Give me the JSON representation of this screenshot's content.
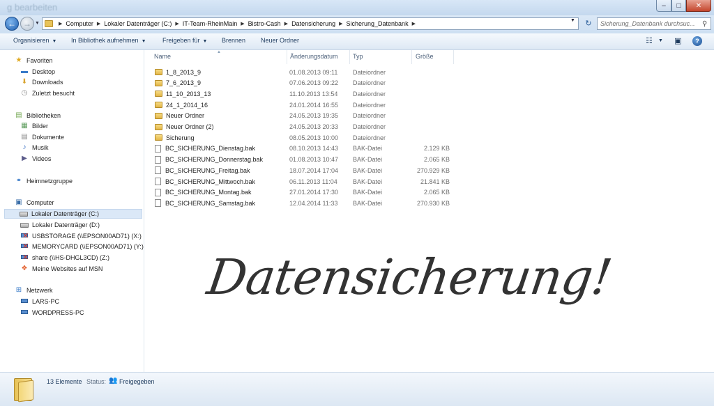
{
  "window": {
    "title_ghost": "g bearbeiten",
    "controls": {
      "minimize": "–",
      "maximize": "□",
      "close": "✕"
    }
  },
  "address": {
    "breadcrumbs": [
      "Computer",
      "Lokaler Datenträger (C:)",
      "IT-Team-RheinMain",
      "Bistro-Cash",
      "Datensicherung",
      "Sicherung_Datenbank"
    ],
    "search_placeholder": "Sicherung_Datenbank durchsuc..."
  },
  "toolbar": {
    "organize": "Organisieren",
    "library": "In Bibliothek aufnehmen",
    "share": "Freigeben für",
    "burn": "Brennen",
    "new_folder": "Neuer Ordner",
    "help": "?"
  },
  "nav": {
    "favorites": {
      "label": "Favoriten",
      "items": [
        "Desktop",
        "Downloads",
        "Zuletzt besucht"
      ]
    },
    "libraries": {
      "label": "Bibliotheken",
      "items": [
        "Bilder",
        "Dokumente",
        "Musik",
        "Videos"
      ]
    },
    "homegroup": "Heimnetzgruppe",
    "computer": {
      "label": "Computer",
      "items": [
        "Lokaler Datenträger (C:)",
        "Lokaler Datenträger (D:)",
        "USBSTORAGE (\\\\EPSON00AD71) (X:)",
        "MEMORYCARD (\\\\EPSON00AD71) (Y:)",
        "share (\\\\HS-DHGL3CD) (Z:)",
        "Meine Websites auf MSN"
      ]
    },
    "network": {
      "label": "Netzwerk",
      "items": [
        "LARS-PC",
        "WORDPRESS-PC"
      ]
    }
  },
  "columns": {
    "name": "Name",
    "date": "Änderungsdatum",
    "type": "Typ",
    "size": "Größe"
  },
  "files": [
    {
      "name": "1_8_2013_9",
      "date": "01.08.2013 09:11",
      "type": "Dateiordner",
      "size": "",
      "kind": "folder"
    },
    {
      "name": "7_6_2013_9",
      "date": "07.06.2013 09:22",
      "type": "Dateiordner",
      "size": "",
      "kind": "folder"
    },
    {
      "name": "11_10_2013_13",
      "date": "11.10.2013 13:54",
      "type": "Dateiordner",
      "size": "",
      "kind": "folder"
    },
    {
      "name": "24_1_2014_16",
      "date": "24.01.2014 16:55",
      "type": "Dateiordner",
      "size": "",
      "kind": "folder"
    },
    {
      "name": "Neuer Ordner",
      "date": "24.05.2013 19:35",
      "type": "Dateiordner",
      "size": "",
      "kind": "folder"
    },
    {
      "name": "Neuer Ordner (2)",
      "date": "24.05.2013 20:33",
      "type": "Dateiordner",
      "size": "",
      "kind": "folder"
    },
    {
      "name": "Sicherung",
      "date": "08.05.2013 10:00",
      "type": "Dateiordner",
      "size": "",
      "kind": "folder"
    },
    {
      "name": "BC_SICHERUNG_Dienstag.bak",
      "date": "08.10.2013 14:43",
      "type": "BAK-Datei",
      "size": "2.129 KB",
      "kind": "file"
    },
    {
      "name": "BC_SICHERUNG_Donnerstag.bak",
      "date": "01.08.2013 10:47",
      "type": "BAK-Datei",
      "size": "2.065 KB",
      "kind": "file"
    },
    {
      "name": "BC_SICHERUNG_Freitag.bak",
      "date": "18.07.2014 17:04",
      "type": "BAK-Datei",
      "size": "270.929 KB",
      "kind": "file"
    },
    {
      "name": "BC_SICHERUNG_Mittwoch.bak",
      "date": "06.11.2013 11:04",
      "type": "BAK-Datei",
      "size": "21.841 KB",
      "kind": "file"
    },
    {
      "name": "BC_SICHERUNG_Montag.bak",
      "date": "27.01.2014 17:30",
      "type": "BAK-Datei",
      "size": "2.065 KB",
      "kind": "file"
    },
    {
      "name": "BC_SICHERUNG_Samstag.bak",
      "date": "12.04.2014 11:33",
      "type": "BAK-Datei",
      "size": "270.930 KB",
      "kind": "file"
    }
  ],
  "status": {
    "count": "13 Elemente",
    "label": "Status:",
    "value": "Freigegeben"
  },
  "overlay_text": "Datensicherung!"
}
